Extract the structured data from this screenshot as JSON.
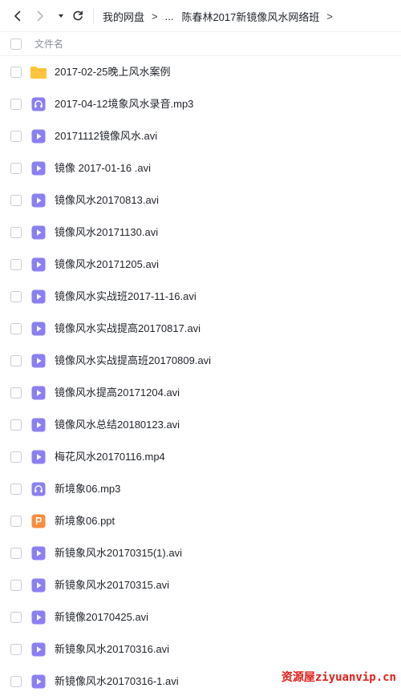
{
  "toolbar": {
    "back_icon": "chevron-left-icon",
    "forward_icon": "chevron-right-icon",
    "history_icon": "caret-down-icon",
    "refresh_icon": "refresh-icon",
    "breadcrumb": {
      "root": "我的网盘",
      "sep": ">",
      "ellipsis": "...",
      "current": "陈春林2017新镜像风水网络班",
      "trail_sep": ">"
    }
  },
  "list_header": {
    "name_label": "文件名"
  },
  "files": [
    {
      "name": "2017-02-25晚上风水案例",
      "type": "folder"
    },
    {
      "name": "2017-04-12境象风水录音.mp3",
      "type": "audio"
    },
    {
      "name": "20171112镜像风水.avi",
      "type": "video"
    },
    {
      "name": "镜像 2017-01-16 .avi",
      "type": "video"
    },
    {
      "name": "镜像风水20170813.avi",
      "type": "video"
    },
    {
      "name": "镜像风水20171130.avi",
      "type": "video"
    },
    {
      "name": "镜像风水20171205.avi",
      "type": "video"
    },
    {
      "name": "镜像风水实战班2017-11-16.avi",
      "type": "video"
    },
    {
      "name": "镜像风水实战提高20170817.avi",
      "type": "video"
    },
    {
      "name": "镜像风水实战提高班20170809.avi",
      "type": "video"
    },
    {
      "name": "镜像风水提高20171204.avi",
      "type": "video"
    },
    {
      "name": "镜像风水总结20180123.avi",
      "type": "video"
    },
    {
      "name": "梅花风水20170116.mp4",
      "type": "video"
    },
    {
      "name": "新境象06.mp3",
      "type": "audio"
    },
    {
      "name": "新境象06.ppt",
      "type": "ppt"
    },
    {
      "name": "新镜象风水20170315(1).avi",
      "type": "video"
    },
    {
      "name": "新镜象风水20170315.avi",
      "type": "video"
    },
    {
      "name": "新镜像20170425.avi",
      "type": "video"
    },
    {
      "name": "新镜象风水20170316.avi",
      "type": "video"
    },
    {
      "name": "新镜像风水20170316-1.avi",
      "type": "video"
    }
  ],
  "colors": {
    "folder": "#ffc53d",
    "media": "#8b7ff4",
    "ppt": "#fa8c3c",
    "watermark": "#e0201a"
  },
  "watermark": {
    "text": "资源屋ziyuanvip.cn"
  }
}
